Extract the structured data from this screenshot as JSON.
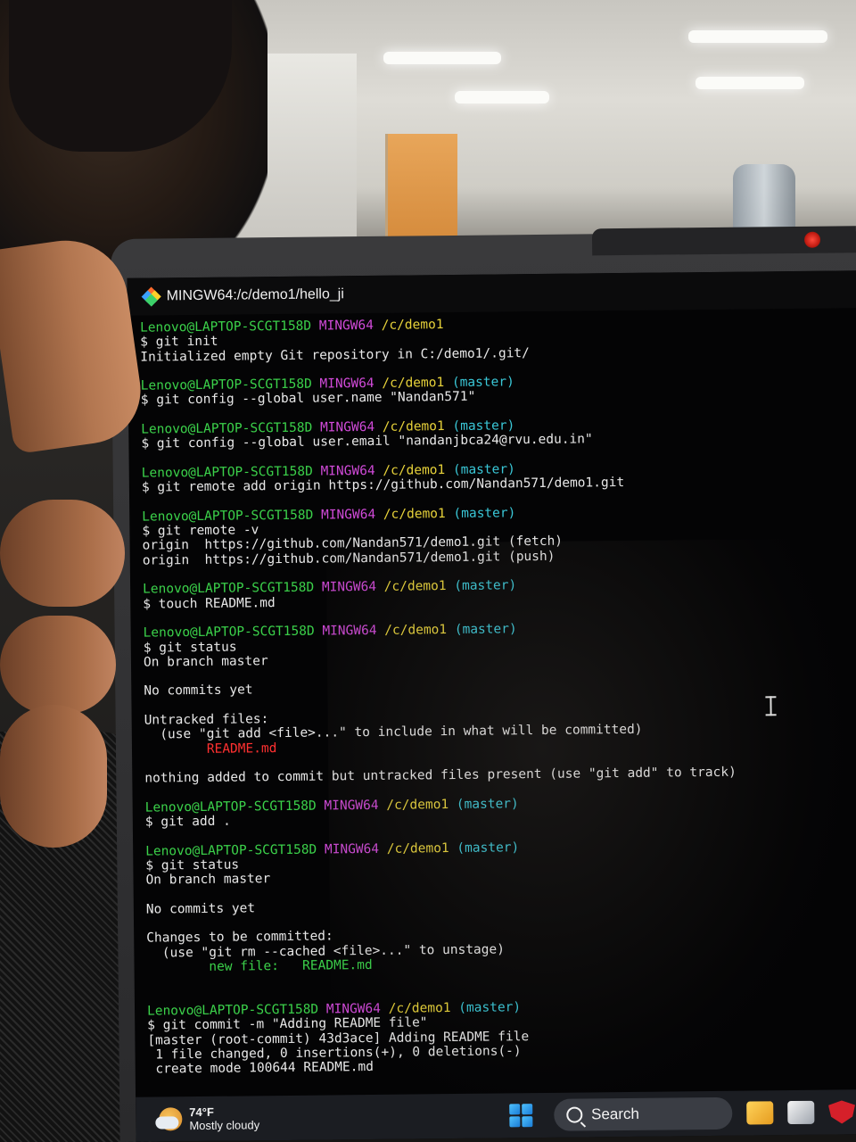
{
  "window": {
    "title": "MINGW64:/c/demo1/hello_ji"
  },
  "terminal": {
    "lines": [
      {
        "type": "prompt",
        "user": "Lenovo@LAPTOP-SCGT158D",
        "shell": "MINGW64",
        "path": "/c/demo1",
        "branch": ""
      },
      {
        "type": "text",
        "text": "$ git init"
      },
      {
        "type": "text",
        "text": "Initialized empty Git repository in C:/demo1/.git/"
      },
      {
        "type": "blank"
      },
      {
        "type": "prompt",
        "user": "Lenovo@LAPTOP-SCGT158D",
        "shell": "MINGW64",
        "path": "/c/demo1",
        "branch": "(master)"
      },
      {
        "type": "text",
        "text": "$ git config --global user.name \"Nandan571\""
      },
      {
        "type": "blank"
      },
      {
        "type": "prompt",
        "user": "Lenovo@LAPTOP-SCGT158D",
        "shell": "MINGW64",
        "path": "/c/demo1",
        "branch": "(master)"
      },
      {
        "type": "text",
        "text": "$ git config --global user.email \"nandanjbca24@rvu.edu.in\""
      },
      {
        "type": "blank"
      },
      {
        "type": "prompt",
        "user": "Lenovo@LAPTOP-SCGT158D",
        "shell": "MINGW64",
        "path": "/c/demo1",
        "branch": "(master)"
      },
      {
        "type": "text",
        "text": "$ git remote add origin https://github.com/Nandan571/demo1.git"
      },
      {
        "type": "blank"
      },
      {
        "type": "prompt",
        "user": "Lenovo@LAPTOP-SCGT158D",
        "shell": "MINGW64",
        "path": "/c/demo1",
        "branch": "(master)"
      },
      {
        "type": "text",
        "text": "$ git remote -v"
      },
      {
        "type": "text",
        "text": "origin  https://github.com/Nandan571/demo1.git (fetch)"
      },
      {
        "type": "text",
        "text": "origin  https://github.com/Nandan571/demo1.git (push)"
      },
      {
        "type": "blank"
      },
      {
        "type": "prompt",
        "user": "Lenovo@LAPTOP-SCGT158D",
        "shell": "MINGW64",
        "path": "/c/demo1",
        "branch": "(master)"
      },
      {
        "type": "text",
        "text": "$ touch README.md"
      },
      {
        "type": "blank"
      },
      {
        "type": "prompt",
        "user": "Lenovo@LAPTOP-SCGT158D",
        "shell": "MINGW64",
        "path": "/c/demo1",
        "branch": "(master)"
      },
      {
        "type": "text",
        "text": "$ git status"
      },
      {
        "type": "text",
        "text": "On branch master"
      },
      {
        "type": "blank"
      },
      {
        "type": "text",
        "text": "No commits yet"
      },
      {
        "type": "blank"
      },
      {
        "type": "text",
        "text": "Untracked files:"
      },
      {
        "type": "text",
        "text": "  (use \"git add <file>...\" to include in what will be committed)"
      },
      {
        "type": "red",
        "text": "        README.md"
      },
      {
        "type": "blank"
      },
      {
        "type": "text",
        "text": "nothing added to commit but untracked files present (use \"git add\" to track)"
      },
      {
        "type": "blank"
      },
      {
        "type": "prompt",
        "user": "Lenovo@LAPTOP-SCGT158D",
        "shell": "MINGW64",
        "path": "/c/demo1",
        "branch": "(master)"
      },
      {
        "type": "text",
        "text": "$ git add ."
      },
      {
        "type": "blank"
      },
      {
        "type": "prompt",
        "user": "Lenovo@LAPTOP-SCGT158D",
        "shell": "MINGW64",
        "path": "/c/demo1",
        "branch": "(master)"
      },
      {
        "type": "text",
        "text": "$ git status"
      },
      {
        "type": "text",
        "text": "On branch master"
      },
      {
        "type": "blank"
      },
      {
        "type": "text",
        "text": "No commits yet"
      },
      {
        "type": "blank"
      },
      {
        "type": "text",
        "text": "Changes to be committed:"
      },
      {
        "type": "text",
        "text": "  (use \"git rm --cached <file>...\" to unstage)"
      },
      {
        "type": "green",
        "text": "        new file:   README.md"
      },
      {
        "type": "blank"
      },
      {
        "type": "blank"
      },
      {
        "type": "prompt",
        "user": "Lenovo@LAPTOP-SCGT158D",
        "shell": "MINGW64",
        "path": "/c/demo1",
        "branch": "(master)"
      },
      {
        "type": "text",
        "text": "$ git commit -m \"Adding README file\""
      },
      {
        "type": "text",
        "text": "[master (root-commit) 43d3ace] Adding README file"
      },
      {
        "type": "text",
        "text": " 1 file changed, 0 insertions(+), 0 deletions(-)"
      },
      {
        "type": "text",
        "text": " create mode 100644 README.md"
      }
    ]
  },
  "taskbar": {
    "weather_temp": "74°F",
    "weather_desc": "Mostly cloudy",
    "search_label": "Search",
    "icons": [
      "weather-icon",
      "windows-start-icon",
      "search-icon",
      "file-explorer-icon",
      "app-stack-icon",
      "mcafee-shield-icon"
    ]
  },
  "colors": {
    "user": "#3bd14a",
    "shell": "#d04ad8",
    "path": "#e7d23a",
    "branch": "#3ac8d8",
    "untracked": "#ff3030",
    "staged": "#3bd14a",
    "terminal_bg": "#040405"
  }
}
